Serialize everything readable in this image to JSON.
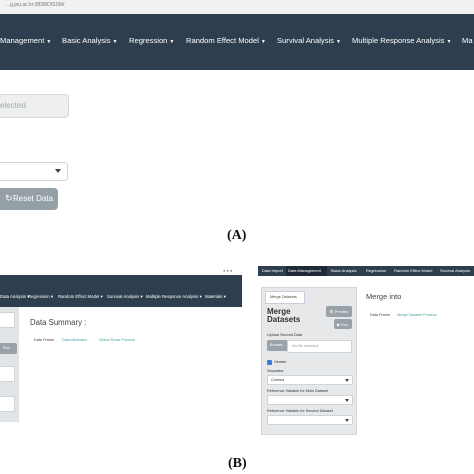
{
  "panel_a": {
    "url": "...g.jnu.ac.kr:3838/DISSM/",
    "nav": [
      {
        "label": "Management"
      },
      {
        "label": "Basic Analysis"
      },
      {
        "label": "Regression"
      },
      {
        "label": "Random Effect Model"
      },
      {
        "label": "Survival Analysis"
      },
      {
        "label": "Multiple Response Analysis"
      },
      {
        "label": "Ma"
      }
    ],
    "selected_placeholder": "elected",
    "reset_label": "Reset Data",
    "reset_icon": "refresh-icon",
    "figure_label": "(A)"
  },
  "panel_b_left": {
    "nav": [
      {
        "label": "Data Analysis"
      },
      {
        "label": "Regression"
      },
      {
        "label": "Random Effect Model"
      },
      {
        "label": "Survival Analysis"
      },
      {
        "label": "Multiple Response Analysis"
      },
      {
        "label": "Materials"
      }
    ],
    "summary_title": "Data Summary :",
    "data_frame_label": "Data Frame",
    "link_1": "Data Attributes",
    "link_2": "Select Rows Process",
    "run_label": "Run"
  },
  "panel_b_right": {
    "tabs": [
      "Data Import",
      "Data Management",
      "Basic Analysis",
      "Regression",
      "Random Effect Model",
      "Survival Analysis"
    ],
    "merge_tab": "Merge Datasets",
    "title": "Merge Datasets",
    "preview_label": "Preview",
    "run_label": "Run",
    "upload_label": "Upload Second Data",
    "browse_label": "Browse...",
    "file_placeholder": "No file selected.",
    "header_label": "Header",
    "separator_label": "Separator",
    "separator_value": "Comma",
    "ref_main_label": "Reference Variable for Main Dataset",
    "ref_second_label": "Reference Variable for Second Dataset",
    "merge_into_title": "Merge into",
    "data_frame_label": "Data Frame",
    "merge_link": "Merge Dataset Process"
  },
  "figure_label_b": "(B)"
}
